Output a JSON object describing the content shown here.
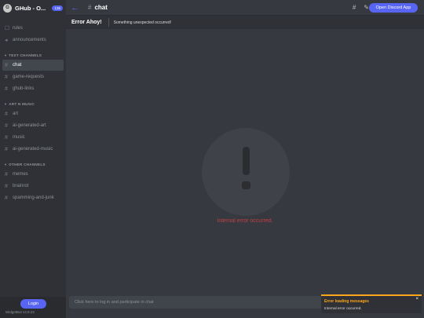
{
  "server": {
    "icon_letter": "G",
    "name": "GHub - O...",
    "badge": "136"
  },
  "sidebar": {
    "top_channels": [
      {
        "icon": "rules-icon",
        "label": "rules"
      },
      {
        "icon": "megaphone-icon",
        "label": "announcements"
      }
    ],
    "categories": [
      {
        "title": "TEXT CHANNELS",
        "channels": [
          "chat",
          "game-requests",
          "ghub-links"
        ]
      },
      {
        "title": "ART N MUSIC",
        "channels": [
          "art",
          "ai-generated-art",
          "music",
          "ai-generated-music"
        ]
      },
      {
        "title": "OTHER CHANNELS",
        "channels": [
          "memes",
          "brainrot",
          "spamming-and-junk"
        ]
      }
    ],
    "selected_channel": "chat",
    "login_label": "Login",
    "version": "WidgetBot v3.9.23"
  },
  "topbar": {
    "hash": "#",
    "channel_title": "chat",
    "open_button": "Open Discord App"
  },
  "error_banner": {
    "title": "Error Ahoy!",
    "subtitle": "Something unexpected occurred!"
  },
  "main": {
    "error_text": "Internal error occurred."
  },
  "composer": {
    "placeholder": "Click here to log in and participate in chat"
  },
  "toast": {
    "title": "Error loading messages",
    "body": "Internal error occurred.",
    "close": "×"
  },
  "colors": {
    "accent": "#5865f2",
    "error": "#ed4245",
    "warning": "#faa61a"
  }
}
